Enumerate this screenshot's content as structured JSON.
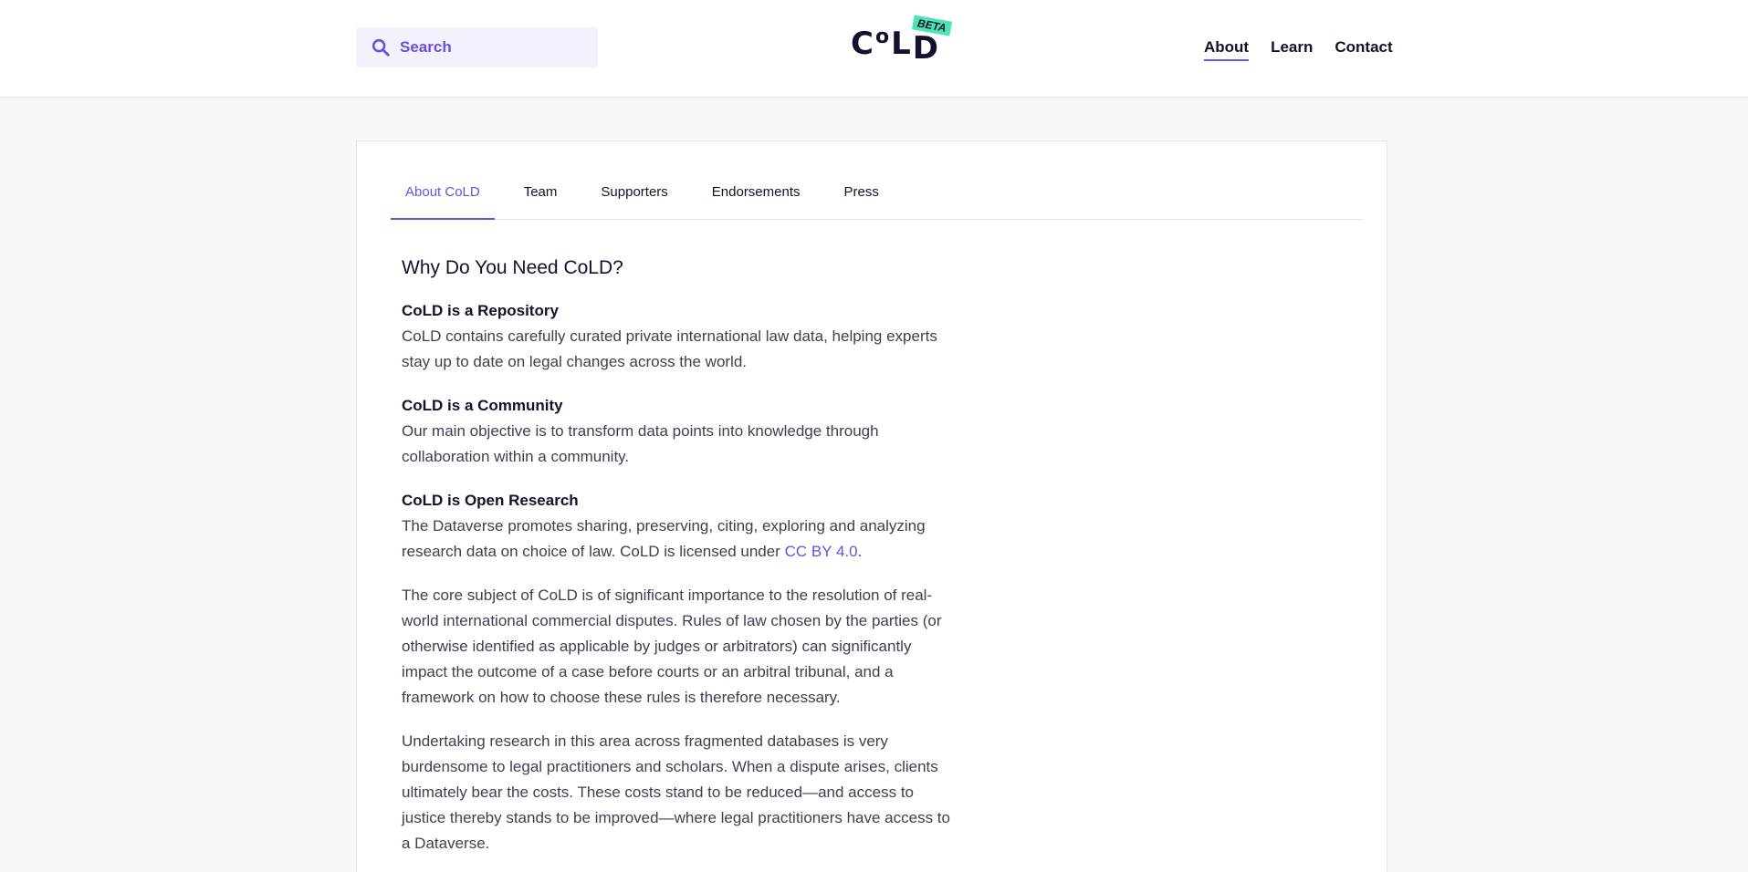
{
  "header": {
    "search_placeholder": "Search",
    "logo": {
      "letters": [
        "C",
        "o",
        "L",
        "D"
      ],
      "badge": "BETA"
    },
    "nav": [
      {
        "label": "About",
        "active": true
      },
      {
        "label": "Learn",
        "active": false
      },
      {
        "label": "Contact",
        "active": false
      }
    ]
  },
  "tabs": [
    {
      "label": "About CoLD",
      "active": true
    },
    {
      "label": "Team",
      "active": false
    },
    {
      "label": "Supporters",
      "active": false
    },
    {
      "label": "Endorsements",
      "active": false
    },
    {
      "label": "Press",
      "active": false
    }
  ],
  "content": {
    "title": "Why Do You Need CoLD?",
    "sections": [
      {
        "heading": "CoLD is a Repository",
        "body": "CoLD contains carefully curated private international law data, helping experts stay up to date on legal changes across the world."
      },
      {
        "heading": "CoLD is a Community",
        "body": "Our main objective is to transform data points into knowledge through collaboration within a community."
      },
      {
        "heading": "CoLD is Open Research",
        "body_before_link": "The Dataverse promotes sharing, preserving, citing, exploring and analyzing research data on choice of law. CoLD is licensed under ",
        "link_text": "CC BY 4.0",
        "body_after_link": "."
      }
    ],
    "paragraphs": [
      "The core subject of CoLD is of significant importance to the resolution of real-world international commercial disputes. Rules of law chosen by the parties (or otherwise identified as applicable by judges or arbitrators) can significantly impact the outcome of a case before courts or an arbitral tribunal, and a framework on how to choose these rules is therefore necessary.",
      "Undertaking research in this area across fragmented databases is very burdensome to legal practitioners and scholars. When a dispute arises, clients ultimately bear the costs. These costs stand to be reduced—and access to justice thereby stands to be improved—where legal practitioners have access to a Dataverse."
    ]
  },
  "colors": {
    "accent": "#6c4ee3",
    "badge": "#4de3b2",
    "text_dark": "#12122e",
    "text_body": "#3d3f52",
    "background": "#f8f8f8"
  },
  "icons": {
    "search": "search-icon"
  }
}
